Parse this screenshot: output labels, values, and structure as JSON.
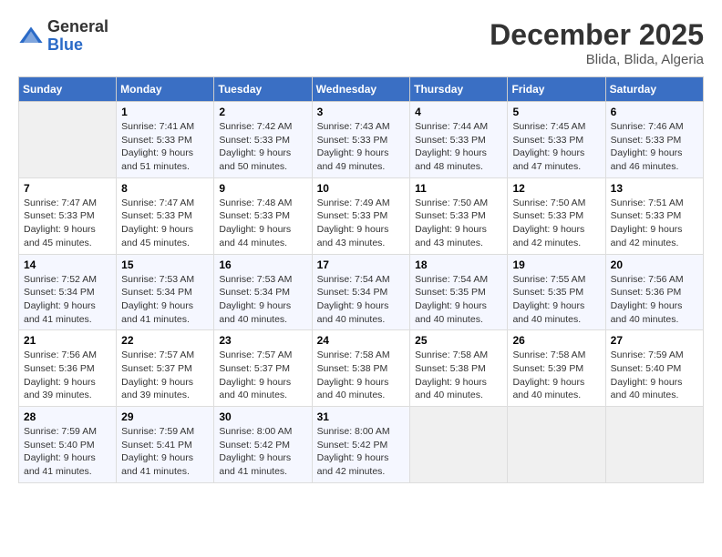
{
  "header": {
    "logo_line1": "General",
    "logo_line2": "Blue",
    "month_title": "December 2025",
    "location": "Blida, Blida, Algeria"
  },
  "weekdays": [
    "Sunday",
    "Monday",
    "Tuesday",
    "Wednesday",
    "Thursday",
    "Friday",
    "Saturday"
  ],
  "weeks": [
    [
      {
        "day": "",
        "info": ""
      },
      {
        "day": "1",
        "info": "Sunrise: 7:41 AM\nSunset: 5:33 PM\nDaylight: 9 hours\nand 51 minutes."
      },
      {
        "day": "2",
        "info": "Sunrise: 7:42 AM\nSunset: 5:33 PM\nDaylight: 9 hours\nand 50 minutes."
      },
      {
        "day": "3",
        "info": "Sunrise: 7:43 AM\nSunset: 5:33 PM\nDaylight: 9 hours\nand 49 minutes."
      },
      {
        "day": "4",
        "info": "Sunrise: 7:44 AM\nSunset: 5:33 PM\nDaylight: 9 hours\nand 48 minutes."
      },
      {
        "day": "5",
        "info": "Sunrise: 7:45 AM\nSunset: 5:33 PM\nDaylight: 9 hours\nand 47 minutes."
      },
      {
        "day": "6",
        "info": "Sunrise: 7:46 AM\nSunset: 5:33 PM\nDaylight: 9 hours\nand 46 minutes."
      }
    ],
    [
      {
        "day": "7",
        "info": "Sunrise: 7:47 AM\nSunset: 5:33 PM\nDaylight: 9 hours\nand 45 minutes."
      },
      {
        "day": "8",
        "info": "Sunrise: 7:47 AM\nSunset: 5:33 PM\nDaylight: 9 hours\nand 45 minutes."
      },
      {
        "day": "9",
        "info": "Sunrise: 7:48 AM\nSunset: 5:33 PM\nDaylight: 9 hours\nand 44 minutes."
      },
      {
        "day": "10",
        "info": "Sunrise: 7:49 AM\nSunset: 5:33 PM\nDaylight: 9 hours\nand 43 minutes."
      },
      {
        "day": "11",
        "info": "Sunrise: 7:50 AM\nSunset: 5:33 PM\nDaylight: 9 hours\nand 43 minutes."
      },
      {
        "day": "12",
        "info": "Sunrise: 7:50 AM\nSunset: 5:33 PM\nDaylight: 9 hours\nand 42 minutes."
      },
      {
        "day": "13",
        "info": "Sunrise: 7:51 AM\nSunset: 5:33 PM\nDaylight: 9 hours\nand 42 minutes."
      }
    ],
    [
      {
        "day": "14",
        "info": "Sunrise: 7:52 AM\nSunset: 5:34 PM\nDaylight: 9 hours\nand 41 minutes."
      },
      {
        "day": "15",
        "info": "Sunrise: 7:53 AM\nSunset: 5:34 PM\nDaylight: 9 hours\nand 41 minutes."
      },
      {
        "day": "16",
        "info": "Sunrise: 7:53 AM\nSunset: 5:34 PM\nDaylight: 9 hours\nand 40 minutes."
      },
      {
        "day": "17",
        "info": "Sunrise: 7:54 AM\nSunset: 5:34 PM\nDaylight: 9 hours\nand 40 minutes."
      },
      {
        "day": "18",
        "info": "Sunrise: 7:54 AM\nSunset: 5:35 PM\nDaylight: 9 hours\nand 40 minutes."
      },
      {
        "day": "19",
        "info": "Sunrise: 7:55 AM\nSunset: 5:35 PM\nDaylight: 9 hours\nand 40 minutes."
      },
      {
        "day": "20",
        "info": "Sunrise: 7:56 AM\nSunset: 5:36 PM\nDaylight: 9 hours\nand 40 minutes."
      }
    ],
    [
      {
        "day": "21",
        "info": "Sunrise: 7:56 AM\nSunset: 5:36 PM\nDaylight: 9 hours\nand 39 minutes."
      },
      {
        "day": "22",
        "info": "Sunrise: 7:57 AM\nSunset: 5:37 PM\nDaylight: 9 hours\nand 39 minutes."
      },
      {
        "day": "23",
        "info": "Sunrise: 7:57 AM\nSunset: 5:37 PM\nDaylight: 9 hours\nand 40 minutes."
      },
      {
        "day": "24",
        "info": "Sunrise: 7:58 AM\nSunset: 5:38 PM\nDaylight: 9 hours\nand 40 minutes."
      },
      {
        "day": "25",
        "info": "Sunrise: 7:58 AM\nSunset: 5:38 PM\nDaylight: 9 hours\nand 40 minutes."
      },
      {
        "day": "26",
        "info": "Sunrise: 7:58 AM\nSunset: 5:39 PM\nDaylight: 9 hours\nand 40 minutes."
      },
      {
        "day": "27",
        "info": "Sunrise: 7:59 AM\nSunset: 5:40 PM\nDaylight: 9 hours\nand 40 minutes."
      }
    ],
    [
      {
        "day": "28",
        "info": "Sunrise: 7:59 AM\nSunset: 5:40 PM\nDaylight: 9 hours\nand 41 minutes."
      },
      {
        "day": "29",
        "info": "Sunrise: 7:59 AM\nSunset: 5:41 PM\nDaylight: 9 hours\nand 41 minutes."
      },
      {
        "day": "30",
        "info": "Sunrise: 8:00 AM\nSunset: 5:42 PM\nDaylight: 9 hours\nand 41 minutes."
      },
      {
        "day": "31",
        "info": "Sunrise: 8:00 AM\nSunset: 5:42 PM\nDaylight: 9 hours\nand 42 minutes."
      },
      {
        "day": "",
        "info": ""
      },
      {
        "day": "",
        "info": ""
      },
      {
        "day": "",
        "info": ""
      }
    ]
  ]
}
